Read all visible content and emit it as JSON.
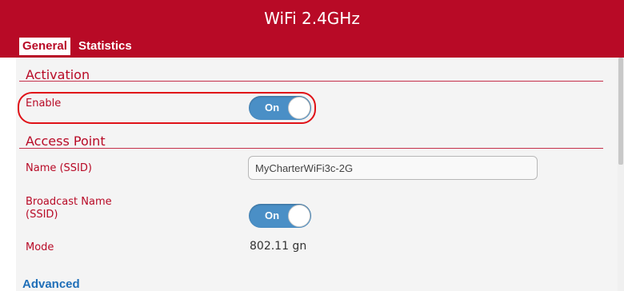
{
  "window": {
    "title": "WiFi 2.4GHz"
  },
  "tabs": [
    {
      "label": "General",
      "active": true
    },
    {
      "label": "Statistics",
      "active": false
    }
  ],
  "activation": {
    "heading": "Activation",
    "enable_label": "Enable",
    "enable_toggle": "On"
  },
  "access_point": {
    "heading": "Access Point",
    "name_label": "Name (SSID)",
    "name_value": "MyCharterWiFi3c-2G",
    "broadcast_label": "Broadcast Name (SSID)",
    "broadcast_toggle": "On",
    "mode_label": "Mode",
    "mode_value": "802.11 gn"
  },
  "advanced_link": "Advanced",
  "colors": {
    "brand_red": "#b80a26",
    "toggle_blue": "#4a8fc6",
    "link_blue": "#1f6fb8",
    "highlight_red": "#e01218"
  }
}
